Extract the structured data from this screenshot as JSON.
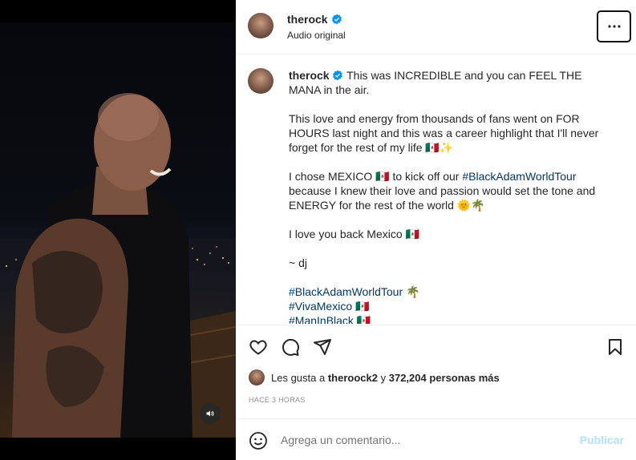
{
  "header": {
    "username": "therock",
    "audio_label": "Audio original",
    "more_icon": "more-horizontal-icon"
  },
  "caption": {
    "username": "therock",
    "paragraphs": [
      "This was INCREDIBLE and you can FEEL THE MANA in the air.",
      "This love and energy from thousands of fans went on FOR HOURS last night and this was a career highlight that I'll never forget for the rest of my life 🇲🇽✨",
      "I chose MEXICO 🇲🇽 to kick off our",
      "because I knew their love and passion would set the tone and ENERGY for the rest of the world 🌞🌴",
      "I love you back Mexico 🇲🇽",
      "~ dj"
    ],
    "inline_hashtag": "#BlackAdamWorldTour",
    "hashtags": [
      "#BlackAdamWorldTour 🌴",
      "#VivaMexico 🇲🇽",
      "#ManInBlack 🇲🇽"
    ]
  },
  "actions": {
    "like_icon": "heart-icon",
    "comment_icon": "comment-icon",
    "share_icon": "send-icon",
    "save_icon": "bookmark-icon"
  },
  "likes": {
    "prefix": "Les gusta a",
    "user": "theroock2",
    "conj": "y",
    "count_text": "372,204 personas más"
  },
  "timestamp": "Hace 3 horas",
  "comment": {
    "placeholder": "Agrega un comentario...",
    "publish_label": "Publicar"
  },
  "colors": {
    "verified": "#0095f6",
    "hashtag": "#00376b",
    "publish_disabled": "#b2dffc"
  }
}
